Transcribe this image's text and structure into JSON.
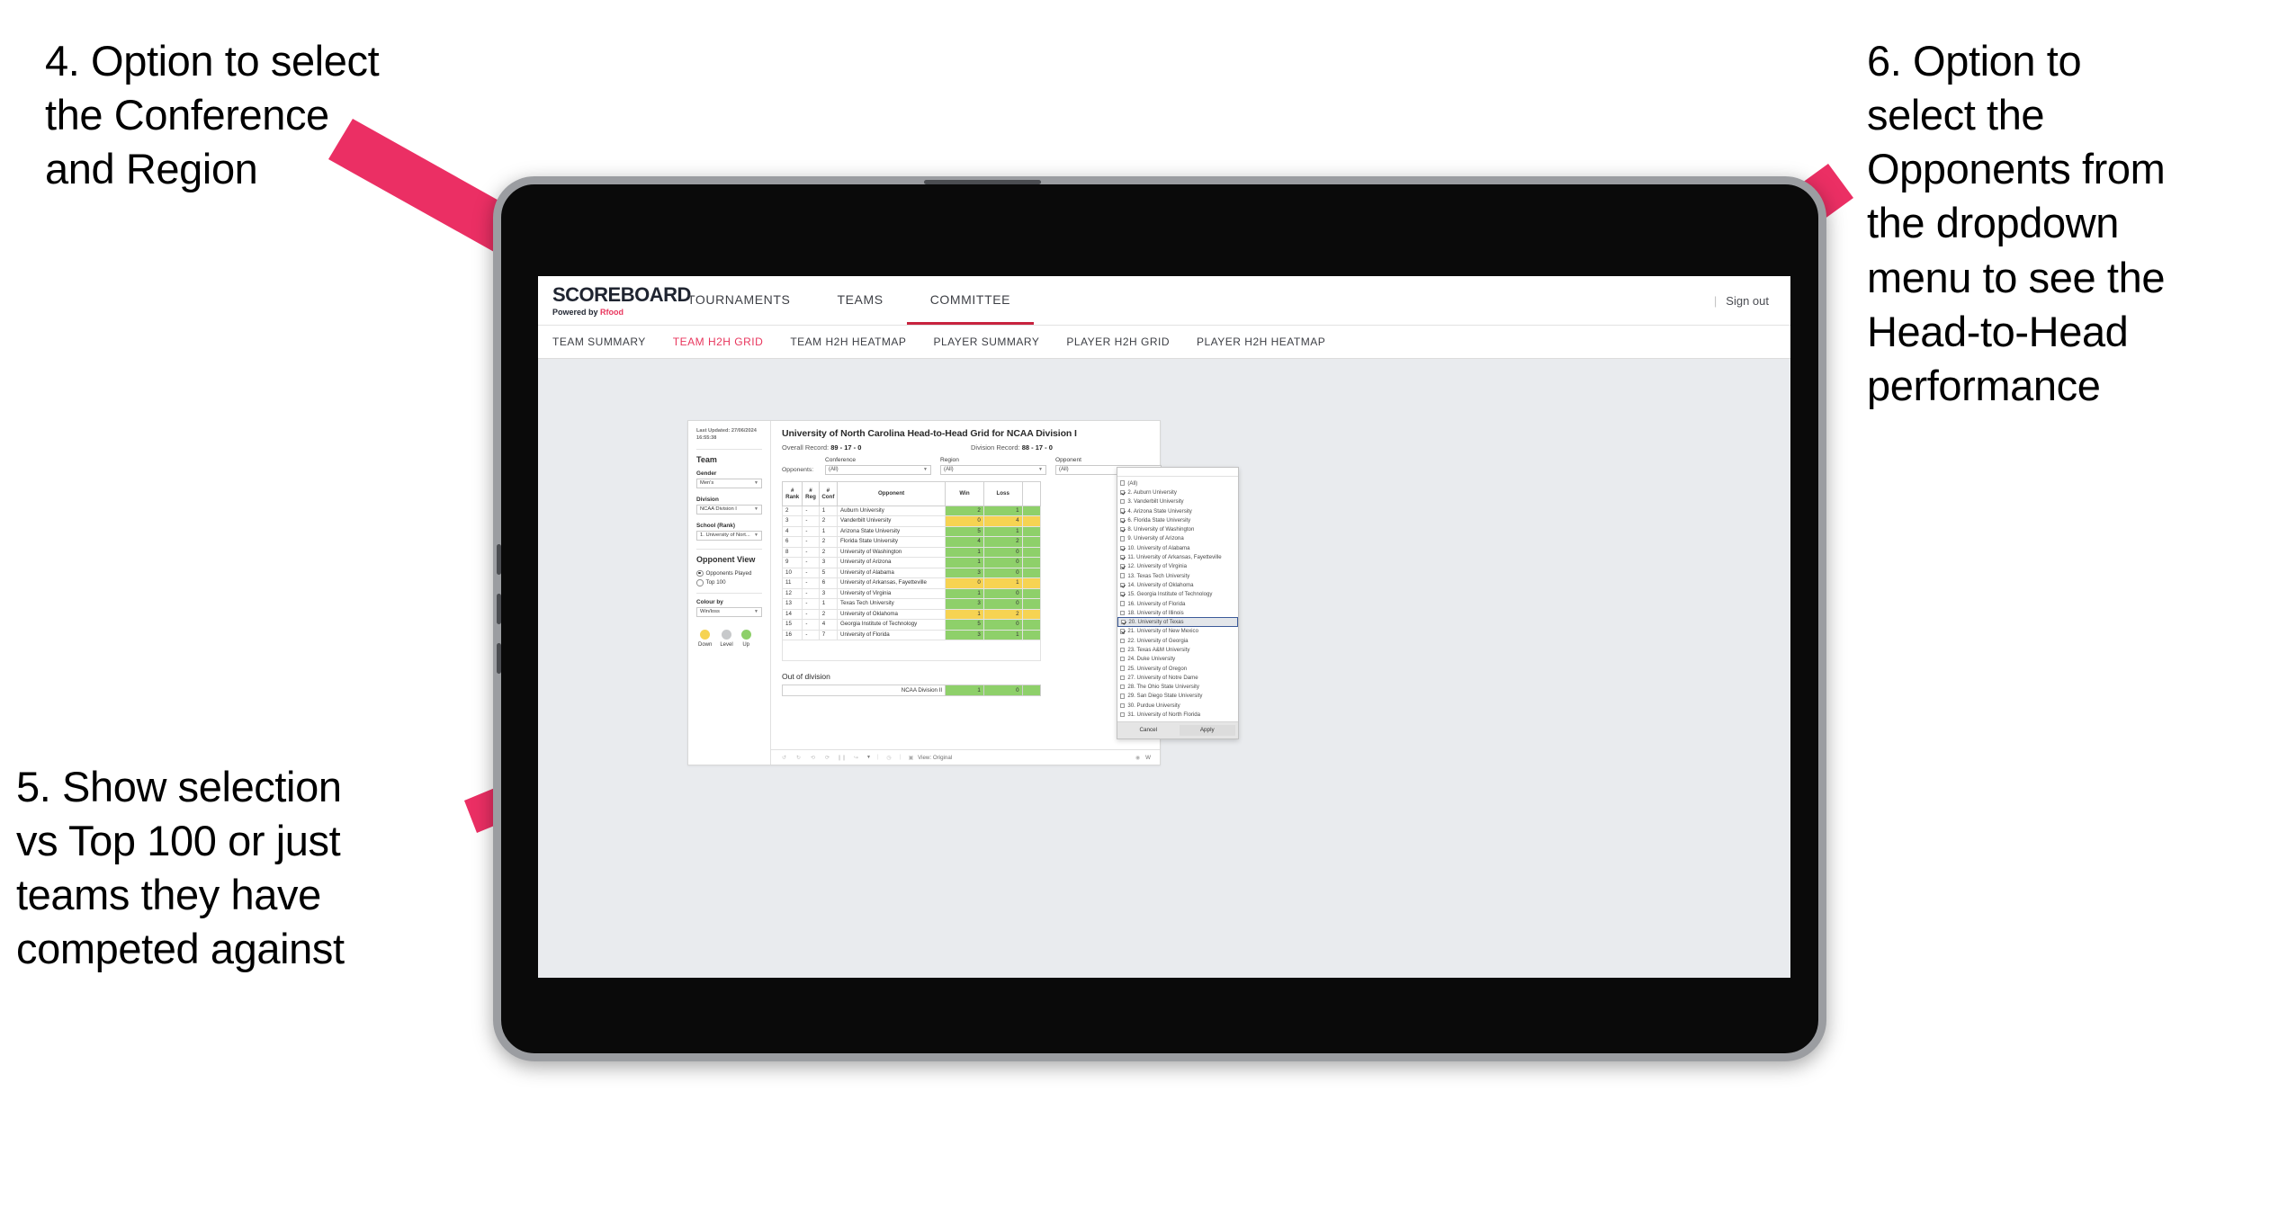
{
  "annotations": [
    {
      "id": "annot-4",
      "text": "4. Option to select\nthe Conference\nand Region"
    },
    {
      "id": "annot-5",
      "text": "5. Show selection\nvs Top 100 or just\nteams they have\ncompeted against"
    },
    {
      "id": "annot-6",
      "text": "6. Option to\nselect the\nOpponents from\nthe dropdown\nmenu to see the\nHead-to-Head\nperformance"
    }
  ],
  "colors": {
    "accent_pink": "#e8365d",
    "nav_active": "#c8233f",
    "up_green": "#8ed06a",
    "down_yellow": "#f6d352",
    "level_grey": "#c7c9cb"
  },
  "app": {
    "logo_main": "SCOREBOARD",
    "logo_sub_prefix": "Powered by ",
    "logo_sub_brand": "Rfood",
    "topnav": [
      {
        "label": "TOURNAMENTS",
        "active": false
      },
      {
        "label": "TEAMS",
        "active": false
      },
      {
        "label": "COMMITTEE",
        "active": true
      }
    ],
    "signout": "Sign out",
    "divider": "|",
    "subnav": [
      {
        "label": "TEAM SUMMARY",
        "active": false
      },
      {
        "label": "TEAM H2H GRID",
        "active": true
      },
      {
        "label": "TEAM H2H HEATMAP",
        "active": false
      },
      {
        "label": "PLAYER SUMMARY",
        "active": false
      },
      {
        "label": "PLAYER H2H GRID",
        "active": false
      },
      {
        "label": "PLAYER H2H HEATMAP",
        "active": false
      }
    ]
  },
  "sidebar": {
    "last_updated": "Last Updated: 27/06/2024 16:55:38",
    "team_heading": "Team",
    "gender_label": "Gender",
    "gender_value": "Men's",
    "division_label": "Division",
    "division_value": "NCAA Division I",
    "school_label": "School (Rank)",
    "school_value": "1. University of Nort...",
    "opponent_view_heading": "Opponent View",
    "radio_opponents_played": "Opponents Played",
    "radio_top100": "Top 100",
    "colour_by_label": "Colour by",
    "colour_by_value": "Win/loss",
    "legend": [
      {
        "label": "Down",
        "color": "#f6d352"
      },
      {
        "label": "Level",
        "color": "#c7c9cb"
      },
      {
        "label": "Up",
        "color": "#8ed06a"
      }
    ]
  },
  "main": {
    "title": "University of North Carolina Head-to-Head Grid for NCAA Division I",
    "overall_record_label": "Overall Record: ",
    "overall_record_value": "89 - 17 - 0",
    "division_record_label": "Division Record: ",
    "division_record_value": "88 - 17 - 0",
    "opponents_label": "Opponents:",
    "filters": [
      {
        "label": "Conference",
        "value": "(All)"
      },
      {
        "label": "Region",
        "value": "(All)"
      },
      {
        "label": "Opponent",
        "value": "(All)"
      }
    ],
    "table_headers": [
      "# Rank",
      "# Reg",
      "# Conf",
      "Opponent",
      "Win",
      "Loss"
    ],
    "out_of_division_title": "Out of division",
    "out_of_division_row": {
      "name": "NCAA Division II",
      "win": "1",
      "loss": "0",
      "state": "up"
    }
  },
  "chart_data": {
    "type": "table",
    "title": "University of North Carolina Head-to-Head Grid for NCAA Division I",
    "columns": [
      "# Rank",
      "# Reg",
      "# Conf",
      "Opponent",
      "Win",
      "Loss"
    ],
    "colour_encoding": {
      "up": "#8ed06a",
      "down": "#f6d352",
      "level": "#c7c9cb"
    },
    "rows": [
      {
        "rank": "2",
        "reg": "-",
        "conf": "1",
        "opponent": "Auburn University",
        "win": "2",
        "loss": "1",
        "state": "up"
      },
      {
        "rank": "3",
        "reg": "-",
        "conf": "2",
        "opponent": "Vanderbilt University",
        "win": "0",
        "loss": "4",
        "state": "down"
      },
      {
        "rank": "4",
        "reg": "-",
        "conf": "1",
        "opponent": "Arizona State University",
        "win": "5",
        "loss": "1",
        "state": "up"
      },
      {
        "rank": "6",
        "reg": "-",
        "conf": "2",
        "opponent": "Florida State University",
        "win": "4",
        "loss": "2",
        "state": "up"
      },
      {
        "rank": "8",
        "reg": "-",
        "conf": "2",
        "opponent": "University of Washington",
        "win": "1",
        "loss": "0",
        "state": "up"
      },
      {
        "rank": "9",
        "reg": "-",
        "conf": "3",
        "opponent": "University of Arizona",
        "win": "1",
        "loss": "0",
        "state": "up"
      },
      {
        "rank": "10",
        "reg": "-",
        "conf": "5",
        "opponent": "University of Alabama",
        "win": "3",
        "loss": "0",
        "state": "up"
      },
      {
        "rank": "11",
        "reg": "-",
        "conf": "6",
        "opponent": "University of Arkansas, Fayetteville",
        "win": "0",
        "loss": "1",
        "state": "down"
      },
      {
        "rank": "12",
        "reg": "-",
        "conf": "3",
        "opponent": "University of Virginia",
        "win": "1",
        "loss": "0",
        "state": "up"
      },
      {
        "rank": "13",
        "reg": "-",
        "conf": "1",
        "opponent": "Texas Tech University",
        "win": "3",
        "loss": "0",
        "state": "up"
      },
      {
        "rank": "14",
        "reg": "-",
        "conf": "2",
        "opponent": "University of Oklahoma",
        "win": "1",
        "loss": "2",
        "state": "down"
      },
      {
        "rank": "15",
        "reg": "-",
        "conf": "4",
        "opponent": "Georgia Institute of Technology",
        "win": "5",
        "loss": "0",
        "state": "up"
      },
      {
        "rank": "16",
        "reg": "-",
        "conf": "7",
        "opponent": "University of Florida",
        "win": "3",
        "loss": "1",
        "state": "up"
      }
    ]
  },
  "dropdown": {
    "items": [
      {
        "label": "(All)",
        "checked": false,
        "selected": false
      },
      {
        "label": "2. Auburn University",
        "checked": true,
        "selected": false
      },
      {
        "label": "3. Vanderbilt University",
        "checked": false,
        "selected": false
      },
      {
        "label": "4. Arizona State University",
        "checked": true,
        "selected": false
      },
      {
        "label": "6. Florida State University",
        "checked": true,
        "selected": false
      },
      {
        "label": "8. University of Washington",
        "checked": true,
        "selected": false
      },
      {
        "label": "9. University of Arizona",
        "checked": false,
        "selected": false
      },
      {
        "label": "10. University of Alabama",
        "checked": true,
        "selected": false
      },
      {
        "label": "11. University of Arkansas, Fayetteville",
        "checked": true,
        "selected": false
      },
      {
        "label": "12. University of Virginia",
        "checked": true,
        "selected": false
      },
      {
        "label": "13. Texas Tech University",
        "checked": false,
        "selected": false
      },
      {
        "label": "14. University of Oklahoma",
        "checked": true,
        "selected": false
      },
      {
        "label": "15. Georgia Institute of Technology",
        "checked": true,
        "selected": false
      },
      {
        "label": "16. University of Florida",
        "checked": false,
        "selected": false
      },
      {
        "label": "18. University of Illinois",
        "checked": false,
        "selected": false
      },
      {
        "label": "20. University of Texas",
        "checked": true,
        "selected": true
      },
      {
        "label": "21. University of New Mexico",
        "checked": true,
        "selected": false
      },
      {
        "label": "22. University of Georgia",
        "checked": false,
        "selected": false
      },
      {
        "label": "23. Texas A&M University",
        "checked": false,
        "selected": false
      },
      {
        "label": "24. Duke University",
        "checked": false,
        "selected": false
      },
      {
        "label": "25. University of Oregon",
        "checked": false,
        "selected": false
      },
      {
        "label": "27. University of Notre Dame",
        "checked": false,
        "selected": false
      },
      {
        "label": "28. The Ohio State University",
        "checked": false,
        "selected": false
      },
      {
        "label": "29. San Diego State University",
        "checked": false,
        "selected": false
      },
      {
        "label": "30. Purdue University",
        "checked": false,
        "selected": false
      },
      {
        "label": "31. University of North Florida",
        "checked": false,
        "selected": false
      }
    ],
    "cancel_label": "Cancel",
    "apply_label": "Apply"
  },
  "toolbar": {
    "view_label": "View: Original",
    "right_label": "W",
    "separator": "|"
  }
}
